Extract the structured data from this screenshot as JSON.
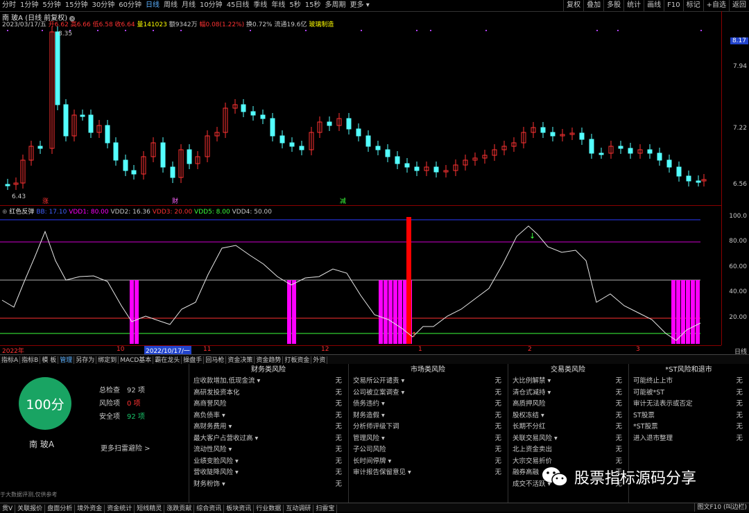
{
  "periods": [
    "分时",
    "1分钟",
    "5分钟",
    "15分钟",
    "30分钟",
    "60分钟",
    "日线",
    "周线",
    "月线",
    "10分钟",
    "45日线",
    "季线",
    "年线",
    "5秒",
    "15秒",
    "多周期",
    "更多 ▾"
  ],
  "active_period": "日线",
  "toolbar_right": [
    "复权",
    "叠加",
    "多股",
    "统计",
    "画线",
    "F10",
    "标记",
    "+自选",
    "返回"
  ],
  "stock_header": {
    "name": "南 玻A",
    "mode": "(日线 前复权)",
    "date": "2023/03/17/五",
    "open": "开6.62",
    "high": "高6.66",
    "low": "低6.58",
    "close": "收6.64",
    "volume": "量141023",
    "amount": "额9342万",
    "change": "幅0.08(1.22%)",
    "turnover": "换0.72%",
    "float": "流通19.6亿",
    "tag": "玻璃制造"
  },
  "price_axis": {
    "current": "8.17",
    "ticks": [
      "7.94",
      "7.22",
      "6.56"
    ]
  },
  "price_annotations": {
    "high": "8.35",
    "low": "6.43"
  },
  "event_markers": [
    "涨",
    "财",
    "减"
  ],
  "colors": {
    "up": "#ff3232",
    "down": "#54ffff",
    "accent": "#5ab0ff",
    "magenta": "#ff00ff",
    "score": "#19a463"
  },
  "indicator": {
    "name": "红色反弹",
    "params": [
      {
        "text": "BB: 17.10",
        "color": "#4060ff"
      },
      {
        "text": "VDD1: 80.00",
        "color": "#ff00ff"
      },
      {
        "text": "VDD2: 16.36",
        "color": "#c8c8c8"
      },
      {
        "text": "VDD3: 20.00",
        "color": "#ff3232"
      },
      {
        "text": "VDD5: 8.00",
        "color": "#3cff3c"
      },
      {
        "text": "VDD4: 50.00",
        "color": "#c8c8c8"
      }
    ],
    "axis_ticks": [
      "100.0",
      "80.00",
      "60.00",
      "40.00",
      "20.00"
    ]
  },
  "date_axis": {
    "labels": [
      "2022年",
      "10",
      "2022/10/17/一",
      "11",
      "12",
      "1",
      "2",
      "3"
    ],
    "period": "日线"
  },
  "function_tabs": [
    "指标A",
    "指标B",
    "模 板",
    "管理",
    "另存为",
    "绑定到",
    "MACD基本",
    "霸在龙头",
    "操盘手",
    "回马枪",
    "资金决策",
    "资金趋势",
    "打板资金",
    "外资"
  ],
  "active_tab": "管理",
  "score": {
    "value": "100分",
    "stock_name": "南 玻A",
    "total_label": "总检查",
    "total": "92 项",
    "risk_label": "风险项",
    "risk": "0 项",
    "safe_label": "安全项",
    "safe": "92 项",
    "more": "更多扫雷避险 >"
  },
  "risk_columns": [
    {
      "title": "财务类风险",
      "items": [
        {
          "label": "应收款增加,低现金流 ▾",
          "value": "无"
        },
        {
          "label": "高研发投资本化",
          "value": "无"
        },
        {
          "label": "高商誉风险",
          "value": "无"
        },
        {
          "label": "高负债率 ▾",
          "value": "无"
        },
        {
          "label": "高财务费用 ▾",
          "value": "无"
        },
        {
          "label": "最大客户占营收过高 ▾",
          "value": "无"
        },
        {
          "label": "流动性风险 ▾",
          "value": "无"
        },
        {
          "label": "业绩变脸风险 ▾",
          "value": "无"
        },
        {
          "label": "营收陡降风险 ▾",
          "value": "无"
        },
        {
          "label": "财务粉饰 ▾",
          "value": "无"
        }
      ]
    },
    {
      "title": "市场类风险",
      "items": [
        {
          "label": "交易所公开谴责 ▾",
          "value": "无"
        },
        {
          "label": "公司被立案调查 ▾",
          "value": "无"
        },
        {
          "label": "债务违约 ▾",
          "value": "无"
        },
        {
          "label": "财务造假 ▾",
          "value": "无"
        },
        {
          "label": "分析师评级下调",
          "value": "无"
        },
        {
          "label": "管理风险 ▾",
          "value": "无"
        },
        {
          "label": "子公司风险",
          "value": "无"
        },
        {
          "label": "长时间停牌 ▾",
          "value": "无"
        },
        {
          "label": "审计报告保留意见 ▾",
          "value": "无"
        }
      ]
    },
    {
      "title": "交易类风险",
      "items": [
        {
          "label": "大比例解禁 ▾",
          "value": "无"
        },
        {
          "label": "清仓式减持 ▾",
          "value": "无"
        },
        {
          "label": "高质押风险",
          "value": "无"
        },
        {
          "label": "股权冻结 ▾",
          "value": "无"
        },
        {
          "label": "长期不分红",
          "value": "无"
        },
        {
          "label": "关联交易风险 ▾",
          "value": "无"
        },
        {
          "label": "北上资金卖出",
          "value": "无"
        },
        {
          "label": "大宗交易折价",
          "value": "无"
        },
        {
          "label": "融券高融",
          "value": "无"
        },
        {
          "label": "成交不活跃 ▾",
          "value": "无"
        }
      ]
    },
    {
      "title": "*ST风险和退市",
      "items": [
        {
          "label": "可能终止上市",
          "value": "无"
        },
        {
          "label": "可能被*ST",
          "value": "无"
        },
        {
          "label": "审计无法表示或否定",
          "value": "无"
        },
        {
          "label": "ST股票",
          "value": "无"
        },
        {
          "label": "*ST股票",
          "value": "无"
        },
        {
          "label": "进入退市整理",
          "value": "无"
        }
      ]
    }
  ],
  "disclaimer": "于大数据评测,仅供参考",
  "watermark": "股票指标源码分享",
  "status_tabs": [
    "贯V",
    "关联报价",
    "盘面分析",
    "境外资金",
    "资金统计",
    "短线精灵",
    "涨跌贡献",
    "综合资讯",
    "板块资讯",
    "行业数据",
    "互动调研",
    "扫雷宝"
  ],
  "status_right": "图文F10 (叫边栏)"
}
